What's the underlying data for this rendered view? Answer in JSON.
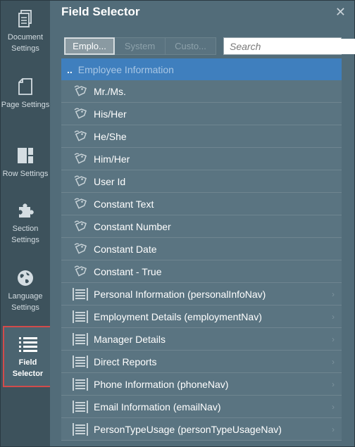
{
  "sidebar": {
    "items": [
      {
        "label": "Document Settings",
        "icon": "document-icon"
      },
      {
        "label": "Page Settings",
        "icon": "page-icon"
      },
      {
        "label": "Row Settings",
        "icon": "row-layout-icon"
      },
      {
        "label": "Section Settings",
        "icon": "puzzle-icon"
      },
      {
        "label": "Language Settings",
        "icon": "globe-icon"
      },
      {
        "label": "Field Selector",
        "icon": "list-icon"
      }
    ]
  },
  "panel": {
    "title": "Field Selector",
    "close": "✕"
  },
  "tabs": [
    "Emplo...",
    "System",
    "Custo..."
  ],
  "search": {
    "placeholder": "Search"
  },
  "list": {
    "header_prefix": "..",
    "header": "Employee Information",
    "fields": [
      "Mr./Ms.",
      "His/Her",
      "He/She",
      "Him/Her",
      "User Id",
      "Constant Text",
      "Constant Number",
      "Constant Date",
      "Constant - True"
    ],
    "groups": [
      "Personal Information (personalInfoNav)",
      "Employment Details (employmentNav)",
      "Manager Details",
      "Direct Reports",
      "Phone Information (phoneNav)",
      "Email Information (emailNav)",
      "PersonTypeUsage (personTypeUsageNav)"
    ],
    "chevron": "›"
  }
}
